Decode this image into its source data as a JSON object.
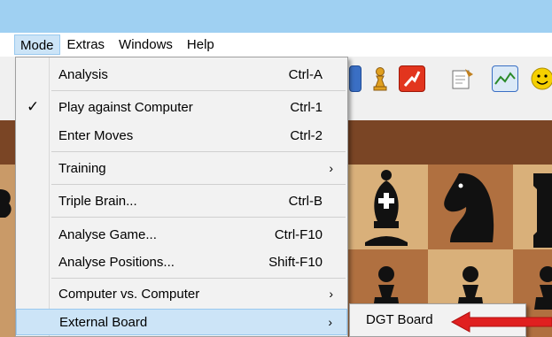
{
  "menubar": {
    "mode": "Mode",
    "extras": "Extras",
    "windows": "Windows",
    "help": "Help"
  },
  "mode_menu": {
    "items": [
      {
        "label": "Analysis",
        "shortcut": "Ctrl-A"
      },
      {
        "label": "Play against Computer",
        "shortcut": "Ctrl-1",
        "check": "✓"
      },
      {
        "label": "Enter Moves",
        "shortcut": "Ctrl-2"
      },
      {
        "label": "Training",
        "arrow": "›"
      },
      {
        "label": "Triple Brain...",
        "shortcut": "Ctrl-B"
      },
      {
        "label": "Analyse Game...",
        "shortcut": "Ctrl-F10"
      },
      {
        "label": "Analyse Positions...",
        "shortcut": "Shift-F10"
      },
      {
        "label": "Computer vs. Computer",
        "arrow": "›"
      },
      {
        "label": "External Board",
        "arrow": "›"
      }
    ]
  },
  "submenu": {
    "item": "DGT Board"
  },
  "icons": {
    "toolbar": [
      "board-icon",
      "pawn-icon",
      "red-tool-icon",
      "note-icon",
      "chart-icon",
      "smiley-icon"
    ],
    "pieces": [
      "black-bishop-icon",
      "black-knight-icon",
      "black-rook-icon",
      "black-pawn-icon"
    ],
    "annotation": "red-arrow-icon"
  },
  "colors": {
    "titlebar": "#9fd0f2",
    "menu_highlight": "#cce4f7",
    "menu_bg": "#f2f2f2",
    "annotation_arrow": "#e02020"
  }
}
